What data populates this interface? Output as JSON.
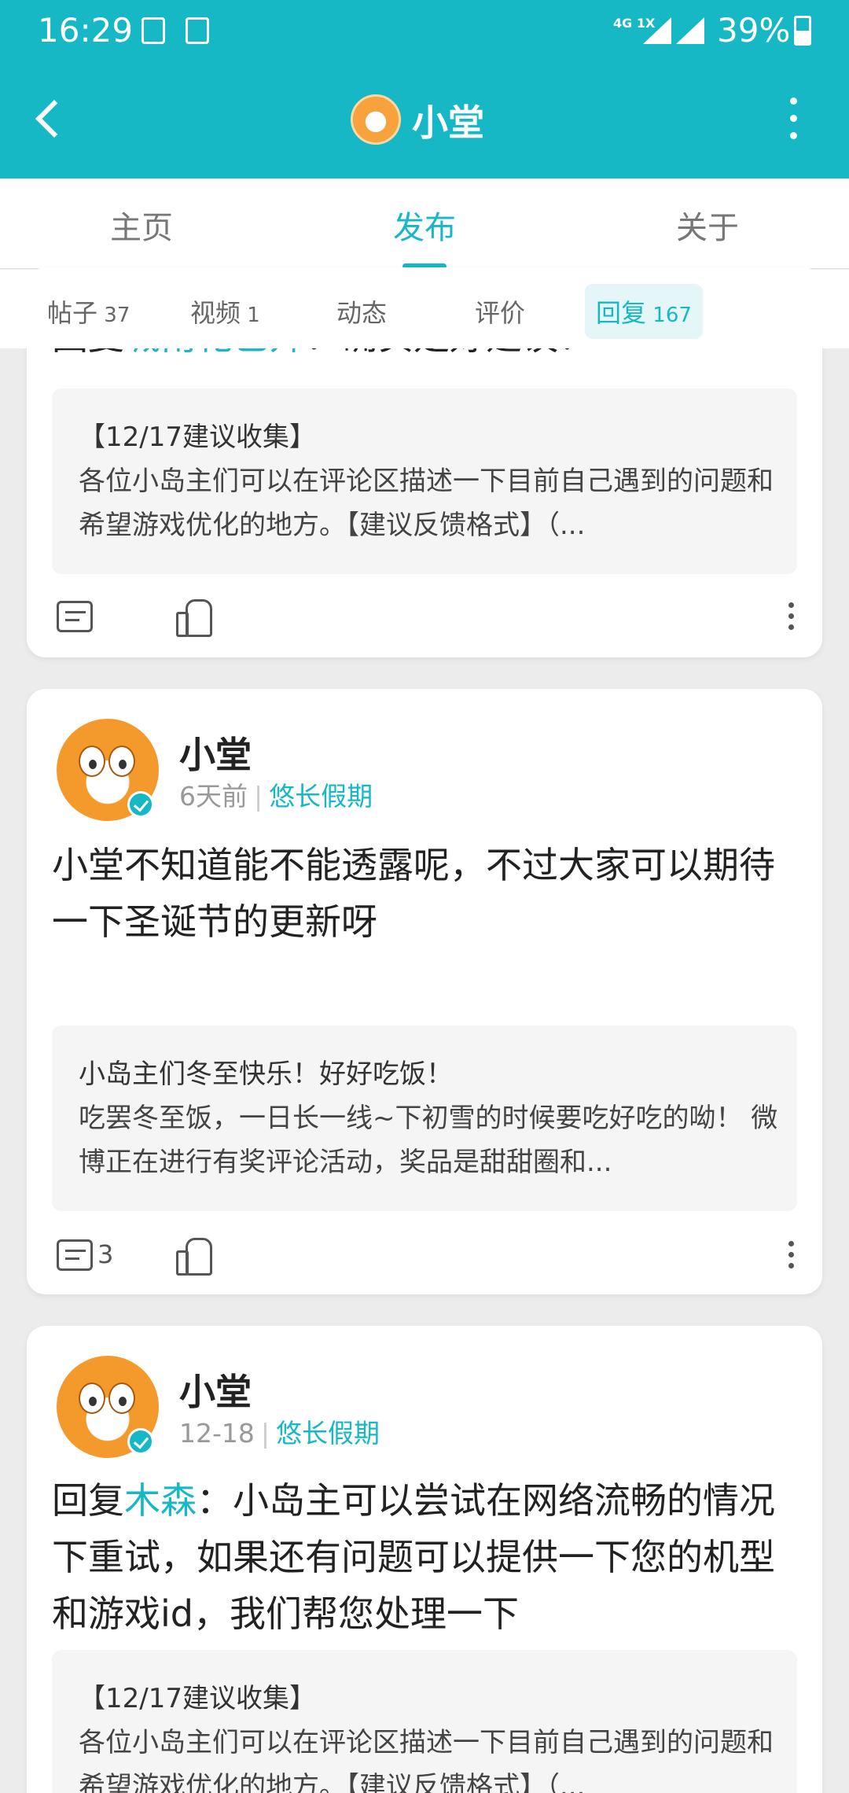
{
  "status": {
    "time": "16:29",
    "network": "4G 1X",
    "battery": "39%"
  },
  "header": {
    "title": "小堂"
  },
  "tabs": [
    {
      "label": "主页"
    },
    {
      "label": "发布"
    },
    {
      "label": "关于"
    }
  ],
  "subtabs": [
    {
      "label": "帖子",
      "count": "37"
    },
    {
      "label": "视频",
      "count": "1"
    },
    {
      "label": "动态",
      "count": ""
    },
    {
      "label": "评价",
      "count": ""
    },
    {
      "label": "回复",
      "count": "167"
    }
  ],
  "cards": [
    {
      "reply_prefix": "回复",
      "reply_mention": "城南花已开",
      "reply_rest": "：确实是好建议！",
      "quote_title": "【12/17建议收集】",
      "quote_body": "各位小岛主们可以在评论区描述一下目前自己遇到的问题和希望游戏优化的地方。【建议反馈格式】（...",
      "comments": ""
    },
    {
      "author": "小堂",
      "time": "6天前",
      "tag": "悠长假期",
      "reply_text": "小堂不知道能不能透露呢，不过大家可以期待一下圣诞节的更新呀",
      "quote_title": "小岛主们冬至快乐！好好吃饭！",
      "quote_body": "吃罢冬至饭，一日长一线~下初雪的时候要吃好吃的呦！ 微博正在进行有奖评论活动，奖品是甜甜圈和...",
      "comments": "3"
    },
    {
      "author": "小堂",
      "time": "12-18",
      "tag": "悠长假期",
      "reply_prefix": "回复",
      "reply_mention": "木森",
      "reply_rest": "：小岛主可以尝试在网络流畅的情况下重试，如果还有问题可以提供一下您的机型和游戏id，我们帮您处理一下",
      "quote_title": "【12/17建议收集】",
      "quote_body": "各位小岛主们可以在评论区描述一下目前自己遇到的问题和希望游戏优化的地方。【建议反馈格式】（..."
    }
  ]
}
